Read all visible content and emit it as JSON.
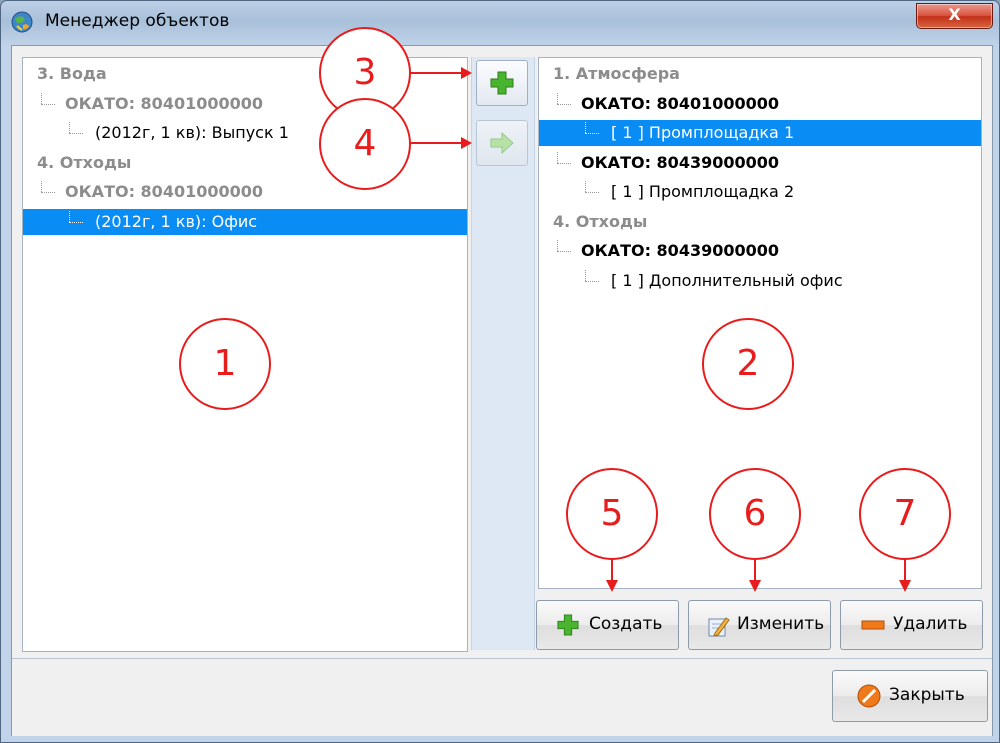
{
  "window": {
    "title": "Менеджер объектов",
    "close_label": "X"
  },
  "left_tree": [
    {
      "text": "3. Вода",
      "style": "grey",
      "level": 0
    },
    {
      "text": "ОКАТО: 80401000000",
      "style": "grey",
      "level": 1
    },
    {
      "text": "(2012г, 1 кв): Выпуск 1",
      "style": "plain",
      "level": 2
    },
    {
      "text": "4. Отходы",
      "style": "grey",
      "level": 0
    },
    {
      "text": "ОКАТО: 80401000000",
      "style": "grey",
      "level": 1
    },
    {
      "text": "(2012г, 1 кв): Офис",
      "style": "plain",
      "level": 2,
      "selected": true
    }
  ],
  "right_tree": [
    {
      "text": "1. Атмосфера",
      "style": "grey",
      "level": 0
    },
    {
      "text": "ОКАТО: 80401000000",
      "style": "bold",
      "level": 1
    },
    {
      "text": "[ 1 ] Промплощадка 1",
      "style": "plain",
      "level": 2,
      "selected": true
    },
    {
      "text": "ОКАТО: 80439000000",
      "style": "bold",
      "level": 1
    },
    {
      "text": "[ 1 ] Промплощадка 2",
      "style": "plain",
      "level": 2
    },
    {
      "text": "4. Отходы",
      "style": "grey",
      "level": 0
    },
    {
      "text": "ОКАТО: 80439000000",
      "style": "bold",
      "level": 1
    },
    {
      "text": "[ 1 ] Дополнительный офис",
      "style": "plain",
      "level": 2
    }
  ],
  "buttons": {
    "create": "Создать",
    "edit": "Изменить",
    "delete": "Удалить",
    "close": "Закрыть"
  },
  "callouts": {
    "c1": "1",
    "c2": "2",
    "c3": "3",
    "c4": "4",
    "c5": "5",
    "c6": "6",
    "c7": "7"
  },
  "colors": {
    "selection": "#0a8cf5",
    "callout": "#e81c1c",
    "plus_green": "#3fae29",
    "minus_orange": "#f07a1a",
    "close_red": "#d9543f"
  },
  "icons": {
    "app": "globe-icon",
    "add": "plus-icon",
    "move": "arrow-right-icon",
    "create": "plus-icon",
    "edit": "pencil-icon",
    "delete": "minus-icon",
    "close": "no-entry-icon"
  }
}
